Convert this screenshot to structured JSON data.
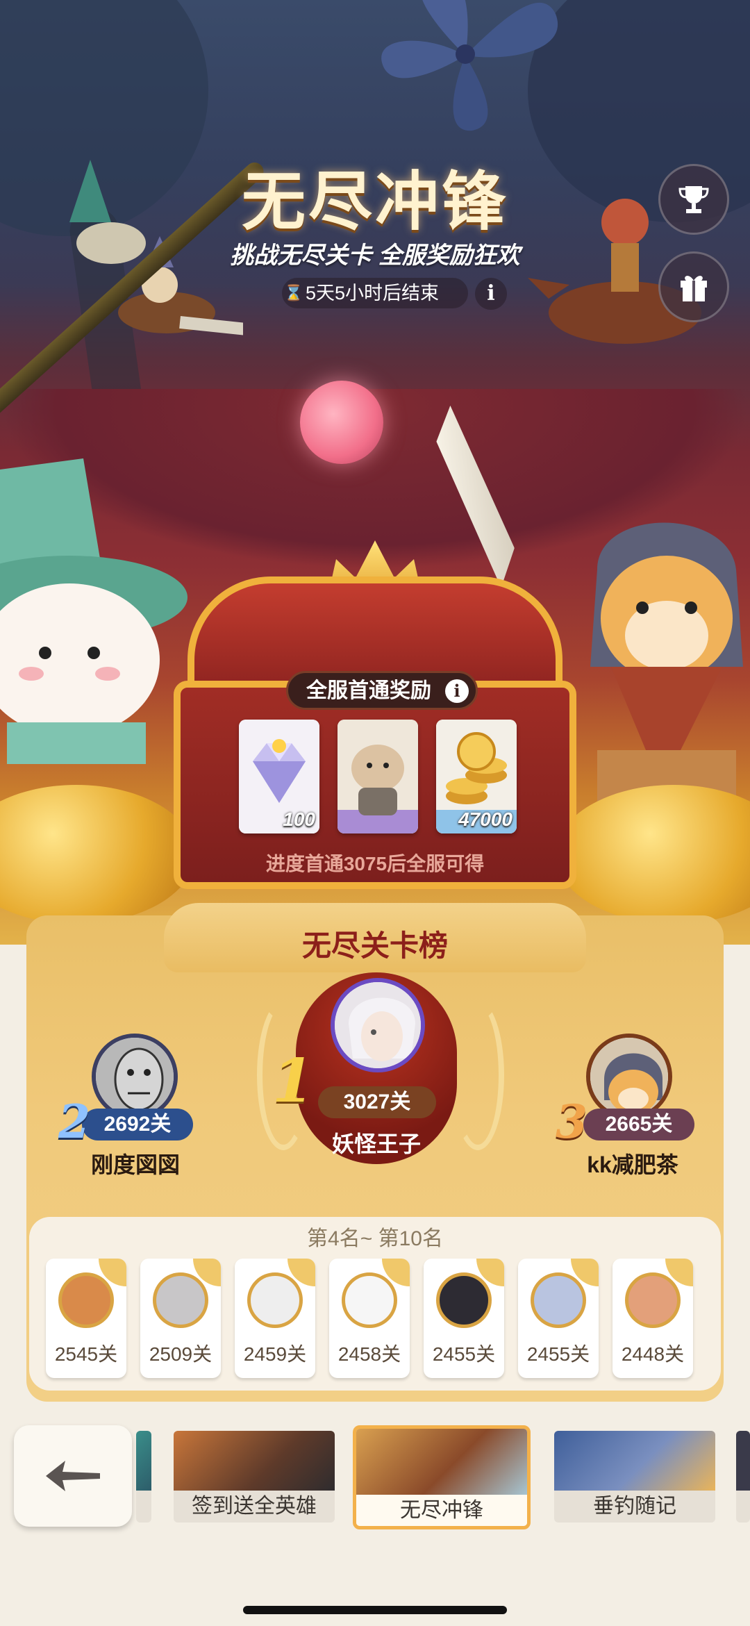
{
  "header": {
    "title": "无尽冲锋",
    "subtitle": "挑战无尽关卡 全服奖励狂欢",
    "timer": "5天5小时后结束"
  },
  "side_buttons": {
    "trophy": "trophy-icon",
    "gift": "gift-icon"
  },
  "rewards": {
    "title": "全服首通奖励",
    "items": [
      {
        "icon": "diamond-icon",
        "qty": "100"
      },
      {
        "icon": "hamster-hero-icon",
        "qty": ""
      },
      {
        "icon": "gold-coins-icon",
        "qty": "47000"
      }
    ],
    "note": "进度首通3075后全服可得"
  },
  "leaderboard": {
    "title": "无尽关卡榜",
    "top": [
      {
        "rank": "1",
        "score": "3027关",
        "name": "妖怪王子"
      },
      {
        "rank": "2",
        "score": "2692关",
        "name": "刚度図図"
      },
      {
        "rank": "3",
        "score": "2665关",
        "name": "kk减肥茶"
      }
    ],
    "others_title": "第4名~ 第10名",
    "others": [
      "2545关",
      "2509关",
      "2459关",
      "2458关",
      "2455关",
      "2455关",
      "2448关"
    ]
  },
  "tabs": [
    {
      "label": "签到送全英雄"
    },
    {
      "label": "无尽冲锋",
      "active": true
    },
    {
      "label": "垂钓随记"
    }
  ],
  "colors": {
    "accent_gold": "#f0b13c",
    "rank_text": "#8c1f1a"
  }
}
